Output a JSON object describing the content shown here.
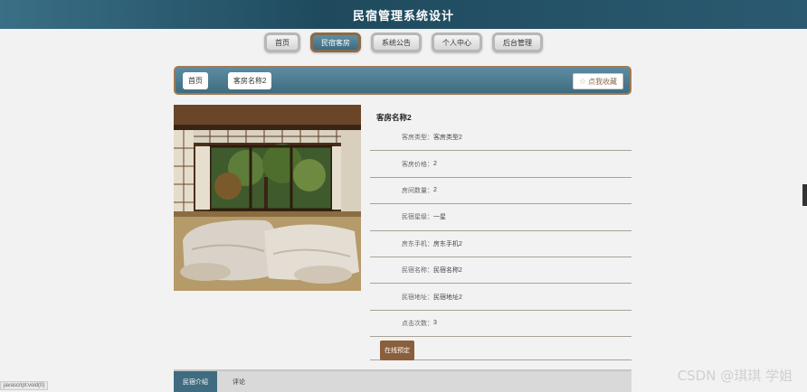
{
  "header": {
    "title": "民宿管理系统设计"
  },
  "nav": {
    "items": [
      "首页",
      "民宿客房",
      "系统公告",
      "个人中心",
      "后台管理"
    ],
    "active_index": 1
  },
  "breadcrumb": {
    "home": "首页",
    "current": "客房名称2",
    "favorite_label": "点我收藏"
  },
  "room": {
    "name": "客房名称2",
    "fields": [
      {
        "label": "客房类型：",
        "value": "客房类型2"
      },
      {
        "label": "客房价格：",
        "value": "2"
      },
      {
        "label": "房间数量：",
        "value": "2"
      },
      {
        "label": "民宿星级：",
        "value": "一星"
      },
      {
        "label": "房东手机：",
        "value": "房东手机2"
      },
      {
        "label": "民宿名称：",
        "value": "民宿名称2"
      },
      {
        "label": "民宿地址：",
        "value": "民宿地址2"
      },
      {
        "label": "点击次数：",
        "value": "3"
      }
    ],
    "book_label": "在线预定"
  },
  "tabs": [
    "民宿介绍",
    "评论"
  ],
  "status_url": "javascript:void(0)",
  "watermark": "CSDN @琪琪 学姐",
  "colors": {
    "accent": "#3f6c80",
    "brand_brown": "#8b5e3c",
    "header": "#1f4a5e"
  }
}
